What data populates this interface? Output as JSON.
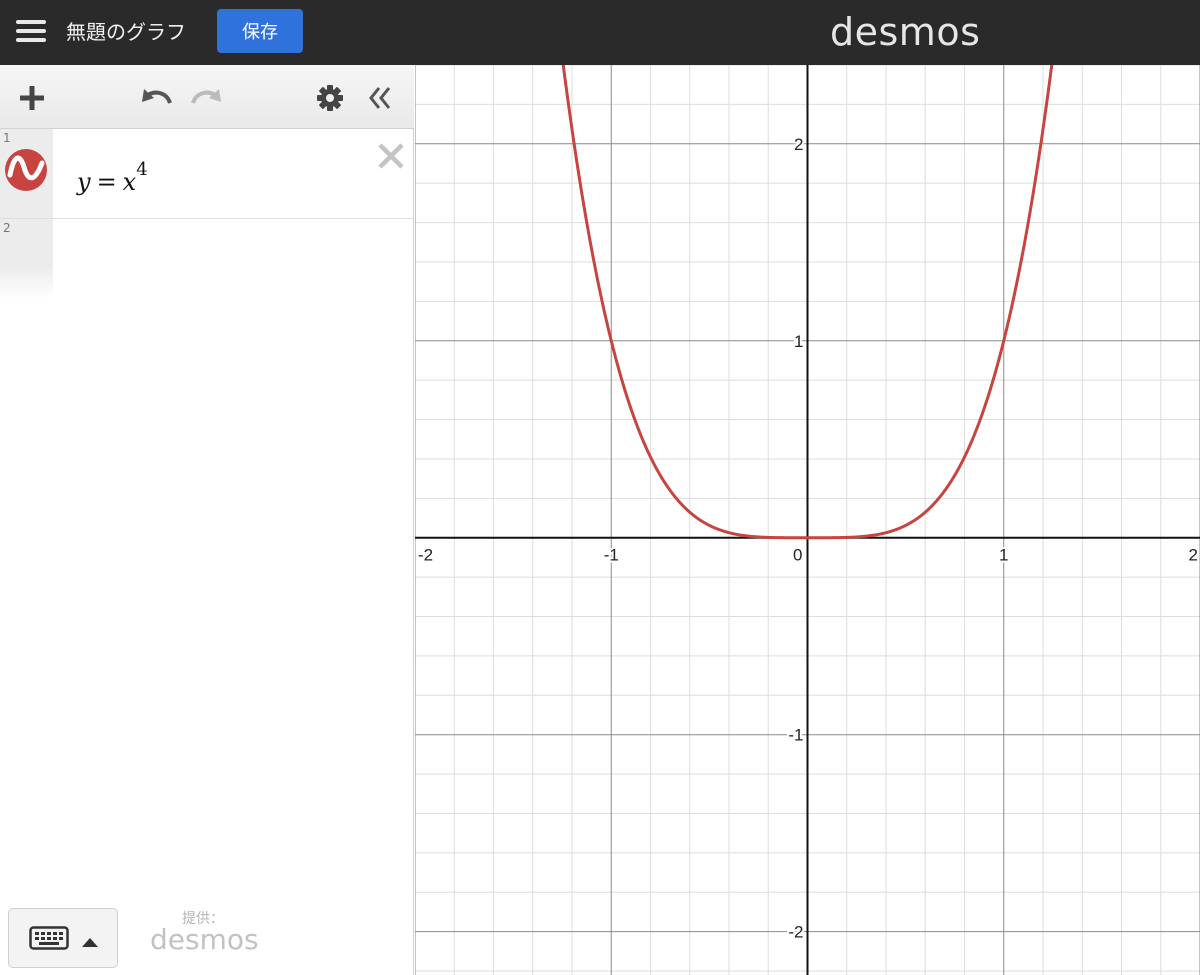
{
  "header": {
    "graph_title": "無題のグラフ",
    "save_label": "保存",
    "brand": "desmos"
  },
  "expressions": [
    {
      "index": "1",
      "variable": "y",
      "equals": "=",
      "base": "x",
      "exponent": "4",
      "color": "#c74440"
    },
    {
      "index": "2"
    }
  ],
  "footer": {
    "powered_label": "提供：",
    "powered_brand": "desmos"
  },
  "chart_data": {
    "type": "line",
    "series": [
      {
        "expression": "y = x^4",
        "color": "#c74440"
      }
    ],
    "xlim": [
      -2.0,
      2.0
    ],
    "ylim": [
      -2.22,
      2.4
    ],
    "x_ticks": [
      "-2",
      "-1",
      "0",
      "1",
      "2"
    ],
    "y_ticks": [
      "2",
      "1",
      "-1",
      "-2"
    ],
    "grid": true,
    "minor_grid": true
  },
  "icons": {
    "menu": "hamburger-icon",
    "add": "plus-icon",
    "undo": "undo-icon",
    "redo": "redo-icon",
    "settings": "gear-icon",
    "collapse": "double-chevron-left-icon",
    "delete": "close-icon",
    "keyboard": "keyboard-icon"
  }
}
